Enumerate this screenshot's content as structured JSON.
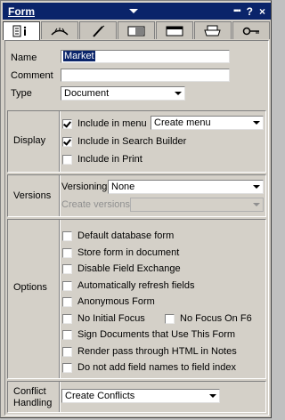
{
  "title": "Form",
  "title_controls": {
    "dots": "▪▪▪",
    "help": "?",
    "close": "×"
  },
  "tabs": [
    {
      "icon": "info-icon"
    },
    {
      "icon": "hat-icon"
    },
    {
      "icon": "brush-icon"
    },
    {
      "icon": "background-icon"
    },
    {
      "icon": "header-icon"
    },
    {
      "icon": "printer-icon"
    },
    {
      "icon": "key-icon"
    }
  ],
  "basics": {
    "name_label": "Name",
    "name_value": "Market",
    "comment_label": "Comment",
    "comment_value": "",
    "type_label": "Type",
    "type_value": "Document"
  },
  "display": {
    "label": "Display",
    "include_menu": "Include in menu",
    "menu_option": "Create menu",
    "include_search": "Include in Search Builder",
    "include_print": "Include in Print"
  },
  "versions": {
    "label": "Versions",
    "versioning_label": "Versioning",
    "versioning_value": "None",
    "create_versions_label": "Create versions",
    "create_versions_value": ""
  },
  "options": {
    "label": "Options",
    "default_db_form": "Default database form",
    "store_form": "Store form in document",
    "disable_field_exchange": "Disable Field Exchange",
    "auto_refresh": "Automatically refresh fields",
    "anonymous_form": "Anonymous Form",
    "no_initial_focus": "No Initial Focus",
    "no_focus_f6": "No Focus On F6",
    "sign_documents": "Sign Documents that Use This Form",
    "render_pass": "Render pass through HTML in Notes",
    "no_field_names": "Do not add field names to field index"
  },
  "conflict": {
    "label_line1": "Conflict",
    "label_line2": "Handling",
    "value": "Create Conflicts"
  }
}
